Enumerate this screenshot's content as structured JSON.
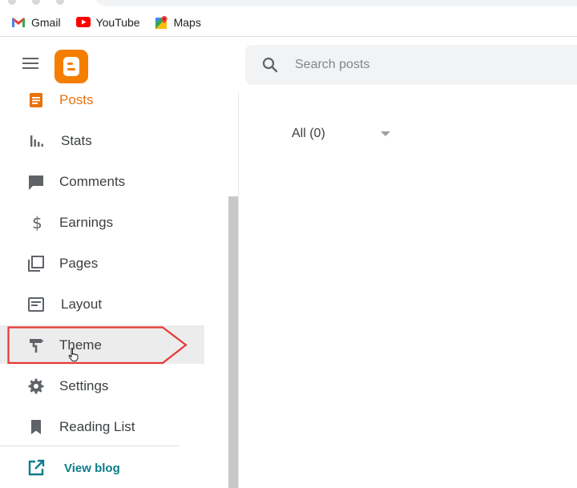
{
  "bookmarks": [
    {
      "label": "Gmail",
      "icon": "gmail-icon"
    },
    {
      "label": "YouTube",
      "icon": "youtube-icon"
    },
    {
      "label": "Maps",
      "icon": "maps-icon"
    }
  ],
  "header": {
    "search_placeholder": "Search posts"
  },
  "sidebar": {
    "items": [
      {
        "label": "Posts",
        "icon": "posts-icon",
        "state": "active"
      },
      {
        "label": "Stats",
        "icon": "stats-icon"
      },
      {
        "label": "Comments",
        "icon": "comments-icon"
      },
      {
        "label": "Earnings",
        "icon": "dollar-icon"
      },
      {
        "label": "Pages",
        "icon": "pages-icon"
      },
      {
        "label": "Layout",
        "icon": "layout-icon"
      },
      {
        "label": "Theme",
        "icon": "theme-icon",
        "state": "hover"
      },
      {
        "label": "Settings",
        "icon": "gear-icon"
      },
      {
        "label": "Reading List",
        "icon": "bookmark-icon"
      }
    ],
    "view_blog": {
      "label": "View blog",
      "icon": "open-in-new-icon"
    }
  },
  "main": {
    "filter_label": "All (0)"
  },
  "colors": {
    "brand": "#f57d00",
    "active": "#e8710a",
    "link": "#0b7c89",
    "annotation": "#e53935"
  }
}
